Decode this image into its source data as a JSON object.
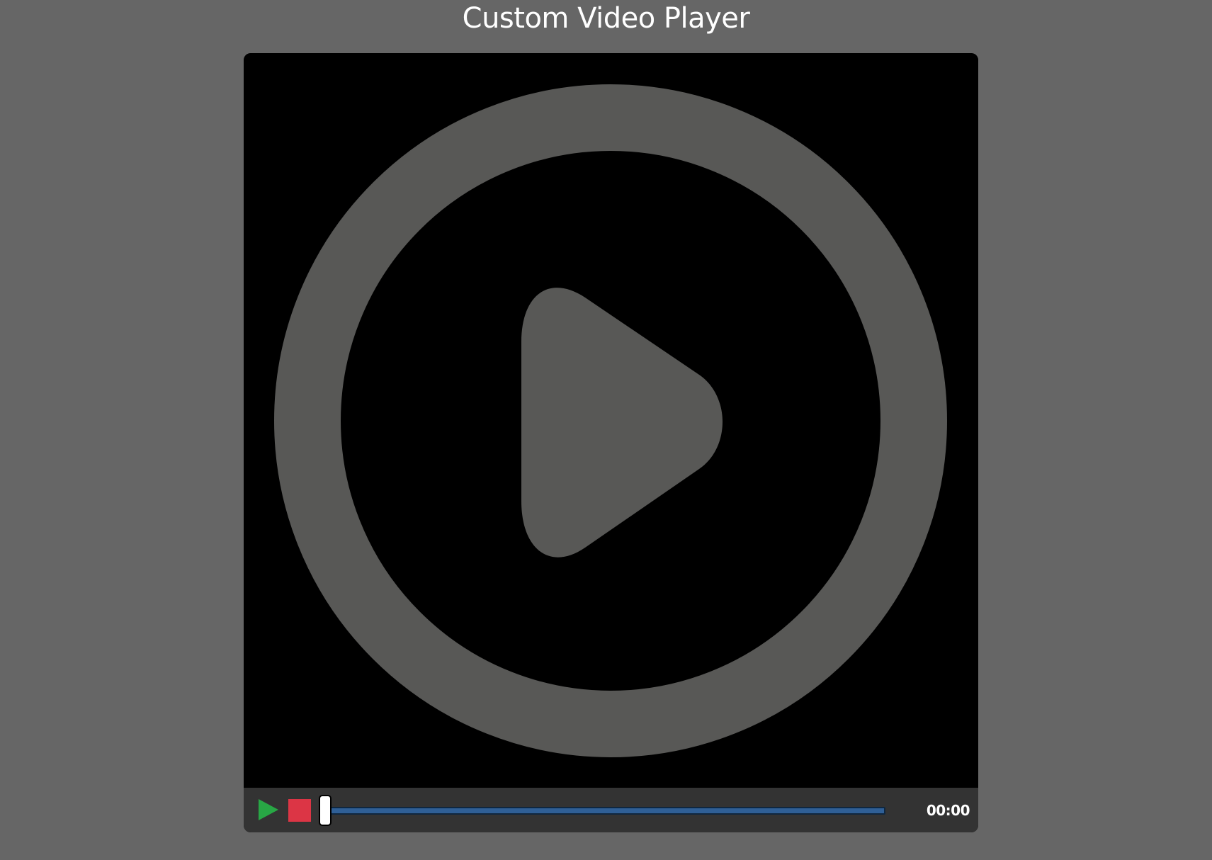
{
  "page": {
    "title": "Custom Video Player"
  },
  "video": {
    "overlay_icon": "play-circle-icon",
    "overlay_color": "#585856",
    "background_color": "#000000"
  },
  "controls": {
    "play_icon": "play-icon",
    "play_color": "#28a745",
    "stop_icon": "stop-icon",
    "stop_color": "#dc3545",
    "progress_fraction": 0,
    "progress_color": "#2f5f96",
    "time": "00:00"
  }
}
